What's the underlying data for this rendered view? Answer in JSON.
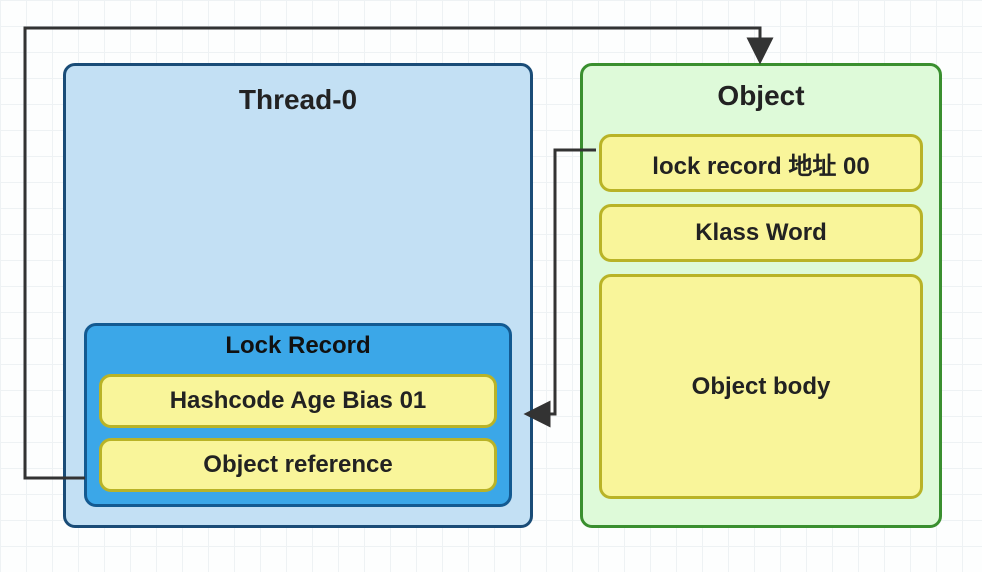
{
  "thread": {
    "title": "Thread-0",
    "lock_record": {
      "title": "Lock Record",
      "rows": [
        "Hashcode Age Bias 01",
        "Object reference"
      ]
    }
  },
  "object": {
    "title": "Object",
    "rows": [
      "lock record 地址 00",
      "Klass Word",
      "Object body"
    ]
  },
  "arrows": [
    {
      "from": "object.lock-record-address",
      "to": "thread.lock-record.hashcode"
    },
    {
      "from": "thread.lock-record.object-reference",
      "to": "object"
    }
  ]
}
